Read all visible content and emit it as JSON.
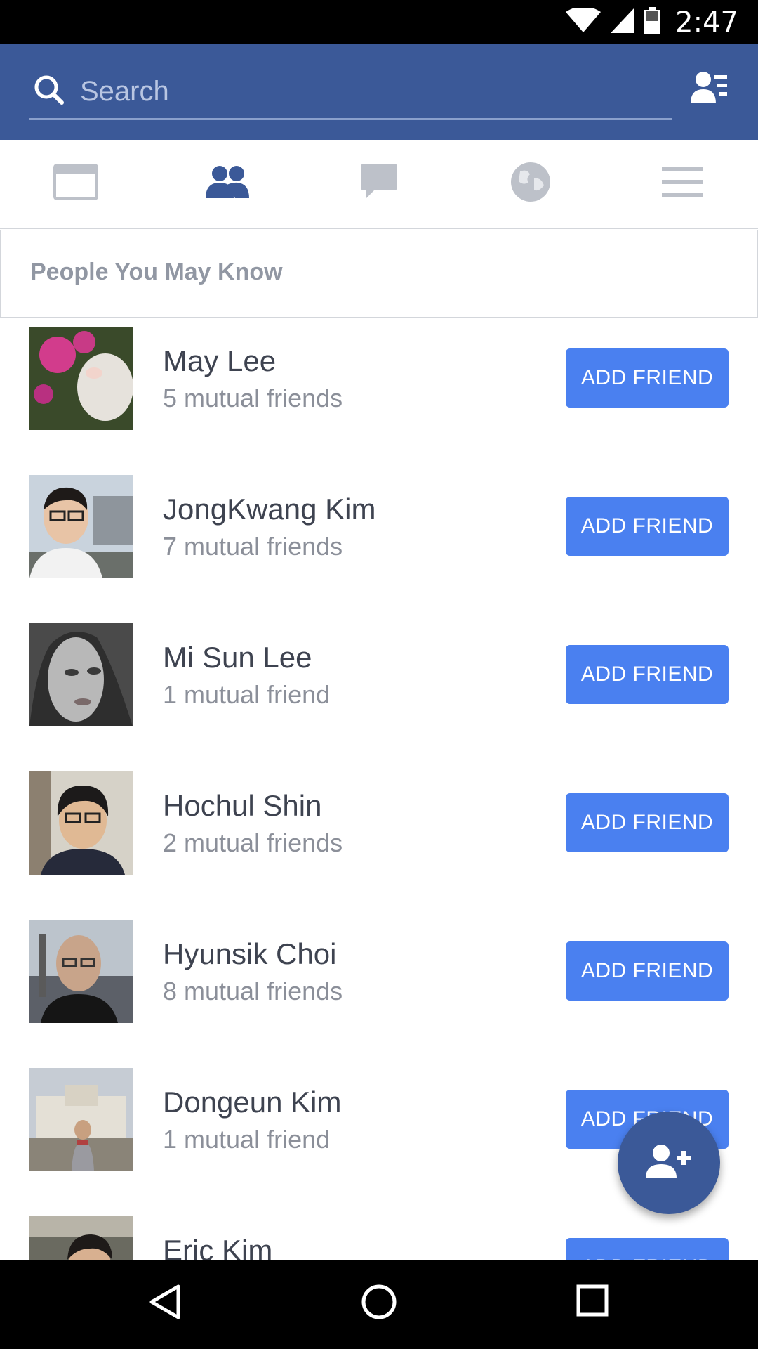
{
  "status_bar": {
    "time": "2:47",
    "icons": [
      "wifi-icon",
      "signal-icon",
      "battery-icon"
    ]
  },
  "search": {
    "placeholder": "Search"
  },
  "tabs": [
    {
      "name": "news-feed",
      "icon": "news-feed-icon",
      "active": false
    },
    {
      "name": "friend-requests",
      "icon": "friends-icon",
      "active": true
    },
    {
      "name": "messages",
      "icon": "message-icon",
      "active": false
    },
    {
      "name": "notifications",
      "icon": "globe-icon",
      "active": false
    },
    {
      "name": "more",
      "icon": "menu-icon",
      "active": false
    }
  ],
  "section": {
    "title": "People You May Know"
  },
  "people": [
    {
      "name": "May Lee",
      "mutual": "5 mutual friends",
      "button": "ADD FRIEND"
    },
    {
      "name": "JongKwang Kim",
      "mutual": "7 mutual friends",
      "button": "ADD FRIEND"
    },
    {
      "name": "Mi Sun  Lee",
      "mutual": "1 mutual friend",
      "button": "ADD FRIEND"
    },
    {
      "name": "Hochul Shin",
      "mutual": "2 mutual friends",
      "button": "ADD FRIEND"
    },
    {
      "name": "Hyunsik Choi",
      "mutual": "8 mutual friends",
      "button": "ADD FRIEND"
    },
    {
      "name": "Dongeun Kim",
      "mutual": "1 mutual friend",
      "button": "ADD FRIEND"
    },
    {
      "name": "Eric Kim",
      "mutual": "",
      "button": "ADD FRIEND"
    }
  ],
  "colors": {
    "brand": "#3b5998",
    "button": "#4a80f0",
    "name_text": "#3e4350",
    "secondary_text": "#8b8f99"
  }
}
